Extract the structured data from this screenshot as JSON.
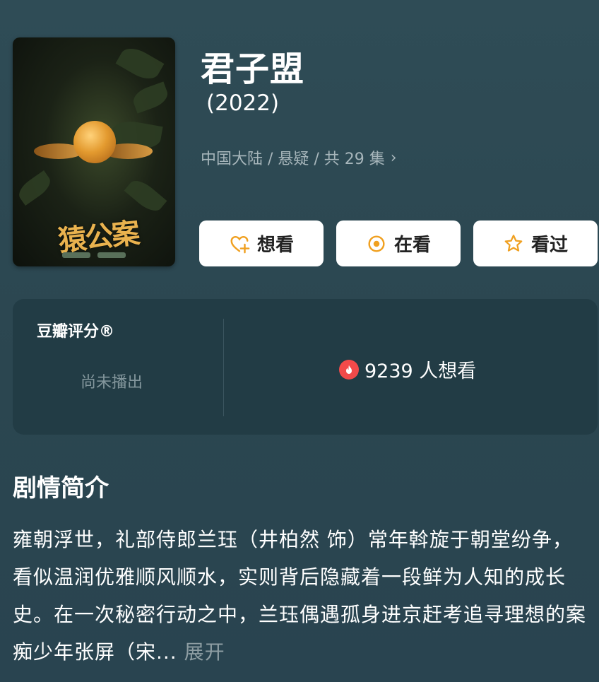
{
  "movie": {
    "title": "君子盟",
    "year": "(2022)",
    "meta": "中国大陆 / 悬疑 / 共 29 集",
    "poster_title": "猿公案"
  },
  "actions": [
    {
      "label": "想看",
      "icon": "heart-plus-icon"
    },
    {
      "label": "在看",
      "icon": "target-icon"
    },
    {
      "label": "看过",
      "icon": "star-icon"
    }
  ],
  "rating": {
    "label": "豆瓣评分®",
    "status": "尚未播出",
    "want_count": "9239 人想看"
  },
  "synopsis": {
    "heading": "剧情简介",
    "text": "雍朝浮世，礼部侍郎兰珏（井柏然 饰）常年斡旋于朝堂纷争，看似温润优雅顺风顺水，实则背后隐藏着一段鲜为人知的成长史。在一次秘密行动之中，兰珏偶遇孤身进京赶考追寻理想的案痴少年张屏（宋...",
    "expand_label": "展开"
  },
  "colors": {
    "accent": "#f0a020",
    "background": "#2d4852",
    "card": "#223c45",
    "fire": "#f24a4a"
  }
}
